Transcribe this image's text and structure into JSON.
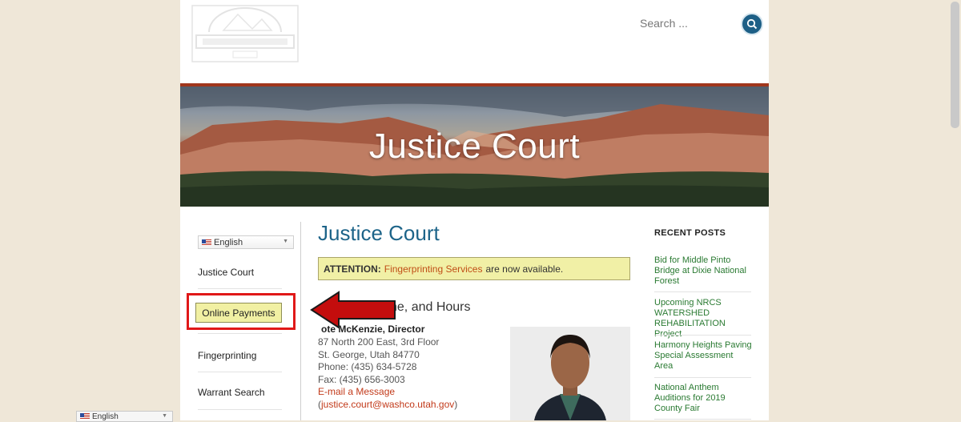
{
  "header": {
    "search_placeholder": "Search ..."
  },
  "hero": {
    "title": "Justice Court"
  },
  "sidebar": {
    "language": "English",
    "items": [
      {
        "label": "Justice Court"
      },
      {
        "label": "Online Payments"
      },
      {
        "label": "Fingerprinting"
      },
      {
        "label": "Warrant Search"
      }
    ]
  },
  "main": {
    "title": "Justice Court",
    "attention": {
      "label": "ATTENTION:",
      "link": "Fingerprinting Services",
      "text": "are now available."
    },
    "section_title_visible": "ne, and Hours",
    "director_visible": "ote McKenzie, Director",
    "address": [
      "87 North 200 East, 3rd Floor",
      "St. George, Utah 84770",
      "Phone: (435) 634-5728",
      "Fax: (435) 656-3003"
    ],
    "email_link": "E-mail a Message",
    "email_address": "(justice.court@washco.utah.gov)"
  },
  "recent_posts": {
    "heading": "RECENT POSTS",
    "posts": [
      {
        "title": "Bid for Middle Pinto Bridge at Dixie National Forest"
      },
      {
        "title": "Upcoming NRCS WATERSHED REHABILITATION Project"
      },
      {
        "title": "Harmony Heights Paving Special Assessment Area"
      },
      {
        "title": "National Anthem Auditions for 2019 County Fair"
      }
    ]
  },
  "translate_widget": {
    "language": "English"
  },
  "colors": {
    "brand_blue": "#1d6489",
    "accent_red": "#a0361c",
    "highlight": "#e01818",
    "link_green": "#2a7a32",
    "link_orange": "#c04e16"
  }
}
